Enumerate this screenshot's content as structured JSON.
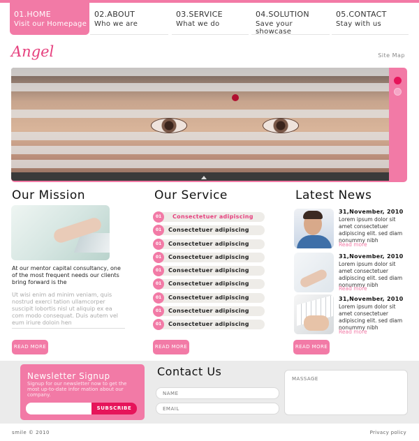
{
  "brand": {
    "logo": "Angel",
    "accent": "#f27aa6",
    "accent_dark": "#e6145a"
  },
  "nav": {
    "items": [
      {
        "num": "01.HOME",
        "sub": "Visit our Homepage"
      },
      {
        "num": "02.ABOUT",
        "sub": "Who we are"
      },
      {
        "num": "03.SERVICE",
        "sub": "What we do"
      },
      {
        "num": "04.SOLUTION",
        "sub": "Save your showcase"
      },
      {
        "num": "05.CONTACT",
        "sub": "Stay with us"
      }
    ]
  },
  "header": {
    "sitemap": "Site Map"
  },
  "mission": {
    "title": "Our Mission",
    "text": "At our mentor capital consultancy, one of the most frequent needs our clients bring forward is the",
    "text2": "Ut wisi enim ad minim veniam, quis nostrud exerci tation ullamcorper suscipit lobortis nisl ut aliquip ex ea com modo consequat. Duis autem vel eum iriure doloin hen",
    "read_more": "READ MORE"
  },
  "service": {
    "title": "Our Service",
    "items": [
      {
        "num": "01",
        "label": "Consectetuer adipiscing"
      },
      {
        "num": "01",
        "label": "Consectetuer adipiscing"
      },
      {
        "num": "01",
        "label": "Consectetuer adipiscing"
      },
      {
        "num": "01",
        "label": "Consectetuer adipiscing"
      },
      {
        "num": "01",
        "label": "Consectetuer adipiscing"
      },
      {
        "num": "01",
        "label": "Consectetuer adipiscing"
      },
      {
        "num": "01",
        "label": "Consectetuer adipiscing"
      },
      {
        "num": "01",
        "label": "Consectetuer adipiscing"
      },
      {
        "num": "01",
        "label": "Consectetuer adipiscing"
      }
    ],
    "read_more": "READ MORE"
  },
  "news": {
    "title": "Latest News",
    "items": [
      {
        "date": "31,November, 2010",
        "body": "Lorem ipsum dolor sit amet consectetuer adipiscing elit. sed diam nonummy nibh",
        "more": "Read more"
      },
      {
        "date": "31,November, 2010",
        "body": "Lorem ipsum dolor sit amet consectetuer adipiscing elit. sed diam nonummy nibh",
        "more": "Read more"
      },
      {
        "date": "31,November, 2010",
        "body": "Lorem ipsum dolor sit amet consectetuer adipiscing elit. sed diam nonummy nibh",
        "more": "Read more"
      }
    ],
    "read_more": "READ MORE"
  },
  "newsletter": {
    "title": "Newsletter Signup",
    "desc": "Signup for our newsletter now to get the most up-to-date infor mation about our company.",
    "subscribe": "SUBSCRIBE"
  },
  "contact": {
    "title": "Contact Us",
    "name_placeholder": "NAME",
    "email_placeholder": "EMAIL",
    "message_placeholder": "MASSAGE"
  },
  "footer": {
    "copyright": "smile © 2010",
    "privacy": "Privacy policy"
  }
}
